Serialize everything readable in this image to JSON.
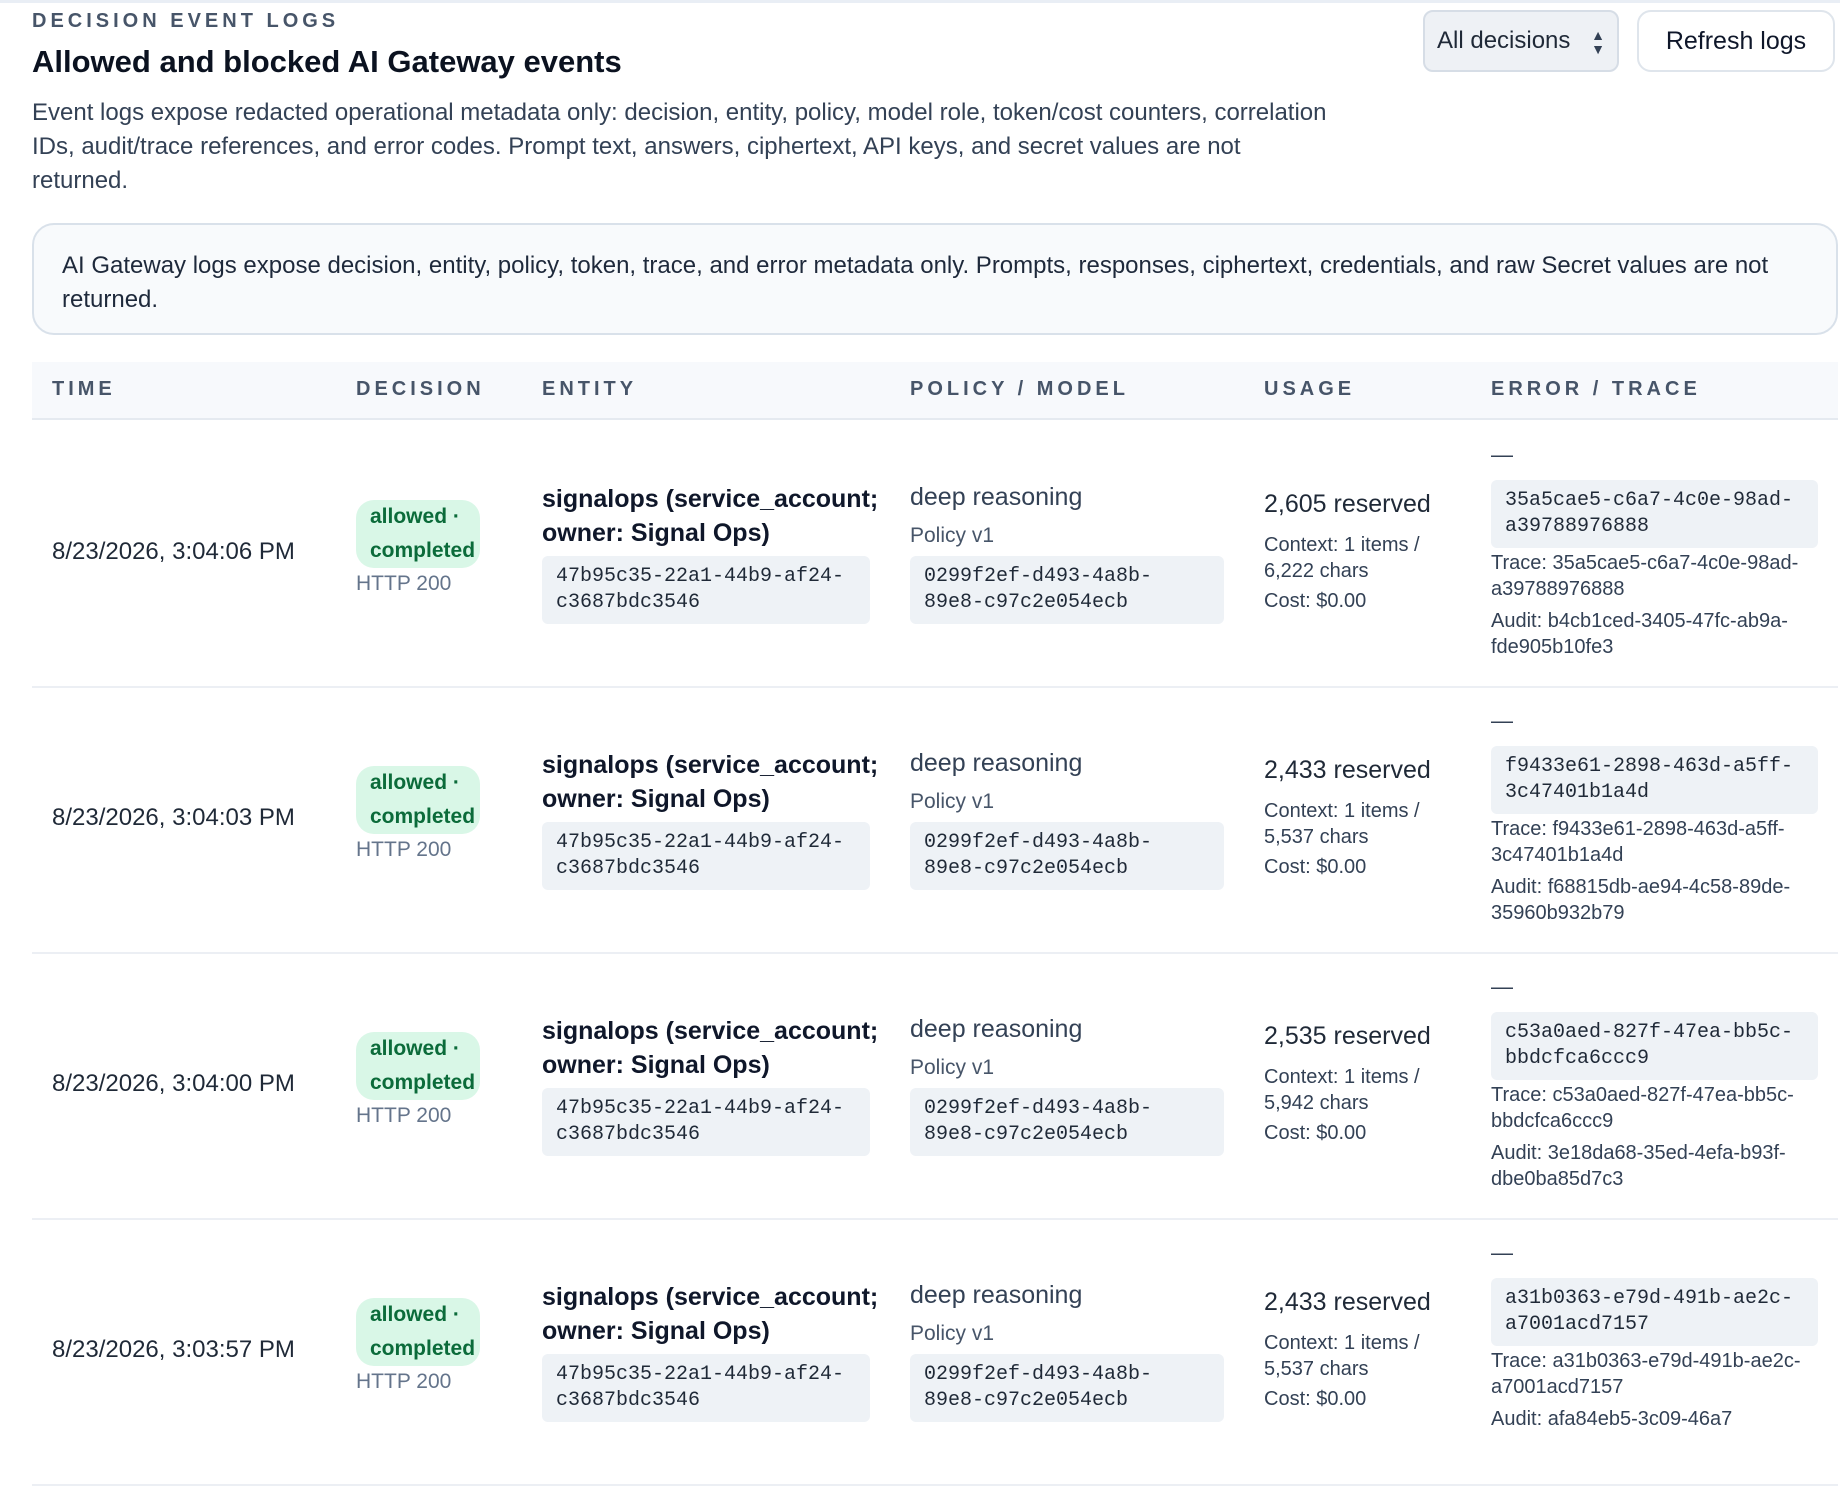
{
  "header": {
    "kicker": "DECISION EVENT LOGS",
    "title": "Allowed and blocked AI Gateway events",
    "description": "Event logs expose redacted operational metadata only: decision, entity, policy, model role, token/cost counters, correlation IDs, audit/trace references, and error codes. Prompt text, answers, ciphertext, API keys, and secret values are not returned."
  },
  "controls": {
    "filter_selected": "All decisions",
    "refresh_label": "Refresh logs"
  },
  "notice": "AI Gateway logs expose decision, entity, policy, token, trace, and error metadata only. Prompts, responses, ciphertext, credentials, and raw Secret values are not returned.",
  "table": {
    "columns": [
      "TIME",
      "DECISION",
      "ENTITY",
      "POLICY / MODEL",
      "USAGE",
      "ERROR / TRACE"
    ],
    "rows": [
      {
        "time": "8/23/2026, 3:04:06 PM",
        "decision_1": "allowed ·",
        "decision_2": "completed",
        "http": "HTTP 200",
        "entity": "signalops (service_account; owner: Signal Ops)",
        "entity_id": "47b95c35-22a1-44b9-af24-c3687bdc3546",
        "policy_role": "deep reasoning",
        "policy_version": "Policy v1",
        "policy_id": "0299f2ef-d493-4a8b-89e8-c97c2e054ecb",
        "usage_reserved": "2,605 reserved",
        "usage_context": "Context: 1 items / 6,222 chars",
        "usage_cost": "Cost: $0.00",
        "error": "—",
        "request_id": "35a5cae5-c6a7-4c0e-98ad-a39788976888",
        "trace": "Trace: 35a5cae5-c6a7-4c0e-98ad-a39788976888",
        "audit": "Audit: b4cb1ced-3405-47fc-ab9a-fde905b10fe3"
      },
      {
        "time": "8/23/2026, 3:04:03 PM",
        "decision_1": "allowed ·",
        "decision_2": "completed",
        "http": "HTTP 200",
        "entity": "signalops (service_account; owner: Signal Ops)",
        "entity_id": "47b95c35-22a1-44b9-af24-c3687bdc3546",
        "policy_role": "deep reasoning",
        "policy_version": "Policy v1",
        "policy_id": "0299f2ef-d493-4a8b-89e8-c97c2e054ecb",
        "usage_reserved": "2,433 reserved",
        "usage_context": "Context: 1 items / 5,537 chars",
        "usage_cost": "Cost: $0.00",
        "error": "—",
        "request_id": "f9433e61-2898-463d-a5ff-3c47401b1a4d",
        "trace": "Trace: f9433e61-2898-463d-a5ff-3c47401b1a4d",
        "audit": "Audit: f68815db-ae94-4c58-89de-35960b932b79"
      },
      {
        "time": "8/23/2026, 3:04:00 PM",
        "decision_1": "allowed ·",
        "decision_2": "completed",
        "http": "HTTP 200",
        "entity": "signalops (service_account; owner: Signal Ops)",
        "entity_id": "47b95c35-22a1-44b9-af24-c3687bdc3546",
        "policy_role": "deep reasoning",
        "policy_version": "Policy v1",
        "policy_id": "0299f2ef-d493-4a8b-89e8-c97c2e054ecb",
        "usage_reserved": "2,535 reserved",
        "usage_context": "Context: 1 items / 5,942 chars",
        "usage_cost": "Cost: $0.00",
        "error": "—",
        "request_id": "c53a0aed-827f-47ea-bb5c-bbdcfca6ccc9",
        "trace": "Trace: c53a0aed-827f-47ea-bb5c-bbdcfca6ccc9",
        "audit": "Audit: 3e18da68-35ed-4efa-b93f-dbe0ba85d7c3"
      },
      {
        "time": "8/23/2026, 3:03:57 PM",
        "decision_1": "allowed ·",
        "decision_2": "completed",
        "http": "HTTP 200",
        "entity": "signalops (service_account; owner: Signal Ops)",
        "entity_id": "47b95c35-22a1-44b9-af24-c3687bdc3546",
        "policy_role": "deep reasoning",
        "policy_version": "Policy v1",
        "policy_id": "0299f2ef-d493-4a8b-89e8-c97c2e054ecb",
        "usage_reserved": "2,433 reserved",
        "usage_context": "Context: 1 items / 5,537 chars",
        "usage_cost": "Cost: $0.00",
        "error": "—",
        "request_id": "a31b0363-e79d-491b-ae2c-a7001acd7157",
        "trace": "Trace: a31b0363-e79d-491b-ae2c-a7001acd7157",
        "audit": "Audit: afa84eb5-3c09-46a7"
      }
    ]
  }
}
